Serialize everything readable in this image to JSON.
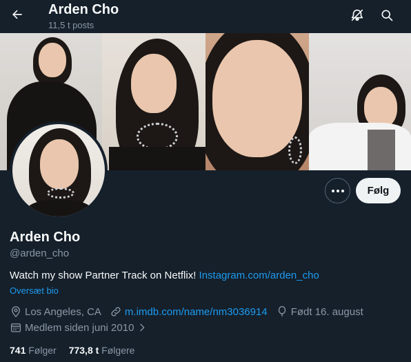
{
  "header": {
    "title": "Arden Cho",
    "post_count": "11,5 t posts"
  },
  "profile": {
    "display_name": "Arden Cho",
    "handle": "@arden_cho",
    "bio_text": "Watch my show Partner Track on Netflix! ",
    "bio_link": "Instagram.com/arden_cho",
    "translate_label": "Oversæt bio",
    "location": "Los Angeles, CA",
    "website": "m.imdb.com/name/nm3036914",
    "birthday": "Født 16. august",
    "joined": "Medlem siden juni 2010"
  },
  "actions": {
    "follow_label": "Følg"
  },
  "stats": {
    "following_count": "741",
    "following_label": "Følger",
    "followers_count": "773,8 t",
    "followers_label": "Følgere"
  },
  "icons": {
    "back": "arrow-left-icon",
    "no_notifications": "bell-slash-icon",
    "search": "search-icon",
    "more": "ellipsis-icon",
    "location": "map-pin-icon",
    "website": "link-icon",
    "birthday": "balloon-icon",
    "joined": "calendar-icon",
    "joined_chevron": "chevron-right-icon"
  },
  "colors": {
    "background": "#15202b",
    "accent": "#1d9bf0",
    "secondary_text": "#8b98a5",
    "follow_button_bg": "#eff3f4"
  }
}
